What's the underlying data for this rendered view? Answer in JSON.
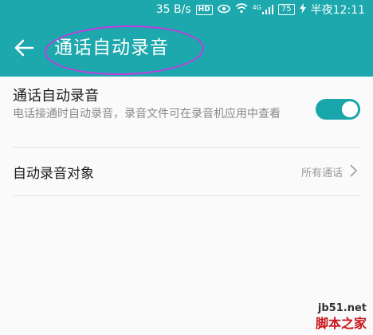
{
  "status_bar": {
    "speed": "35 B/s",
    "hd_badge": "HD",
    "signal_label": "4G",
    "battery": "75",
    "time": "半夜12:11"
  },
  "app_bar": {
    "title": "通话自动录音",
    "back_icon": "back-arrow-icon",
    "color": "#1ca8ad"
  },
  "settings": {
    "auto_record": {
      "title": "通话自动录音",
      "description": "电话接通时自动录音，录音文件可在录音机应用中查看",
      "enabled": true
    },
    "record_target": {
      "label": "自动录音对象",
      "value": "所有通话"
    }
  },
  "watermark": {
    "url": "jb51.net",
    "brand": "脚本之家"
  }
}
